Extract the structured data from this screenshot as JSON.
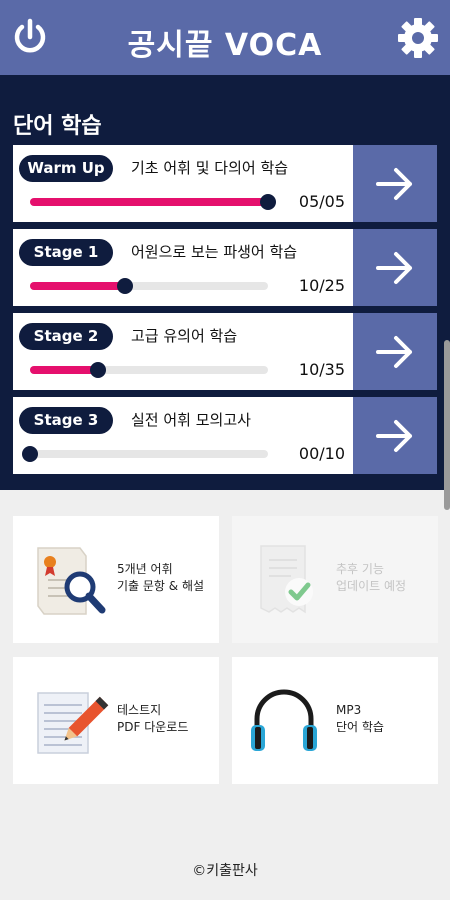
{
  "header": {
    "title": "공시끝 VOCA"
  },
  "study": {
    "heading": "단어 학습",
    "stages": [
      {
        "badge": "Warm Up",
        "description": "기초 어휘 및 다의어 학습",
        "count": "05/05",
        "progress": 1.0
      },
      {
        "badge": "Stage 1",
        "description": "어원으로 보는 파생어 학습",
        "count": "10/25",
        "progress": 0.4
      },
      {
        "badge": "Stage 2",
        "description": "고급 유의어 학습",
        "count": "10/35",
        "progress": 0.286
      },
      {
        "badge": "Stage 3",
        "description": "실전 어휘 모의고사",
        "count": "00/10",
        "progress": 0.0
      }
    ]
  },
  "tiles": [
    {
      "label": "5개년 어휘\n기출 문항 & 해설",
      "icon": "document-search-icon",
      "enabled": true
    },
    {
      "label": "추후 기능\n업데이트 예정",
      "icon": "document-check-icon",
      "enabled": false
    },
    {
      "label": "테스트지\nPDF 다운로드",
      "icon": "notepad-pencil-icon",
      "enabled": true
    },
    {
      "label": "MP3\n단어 학습",
      "icon": "headphones-icon",
      "enabled": true
    }
  ],
  "footer": {
    "copyright": "©키출판사"
  },
  "colors": {
    "header": "#5a6aa8",
    "navy": "#0f1c3e",
    "progress": "#e5106d"
  }
}
